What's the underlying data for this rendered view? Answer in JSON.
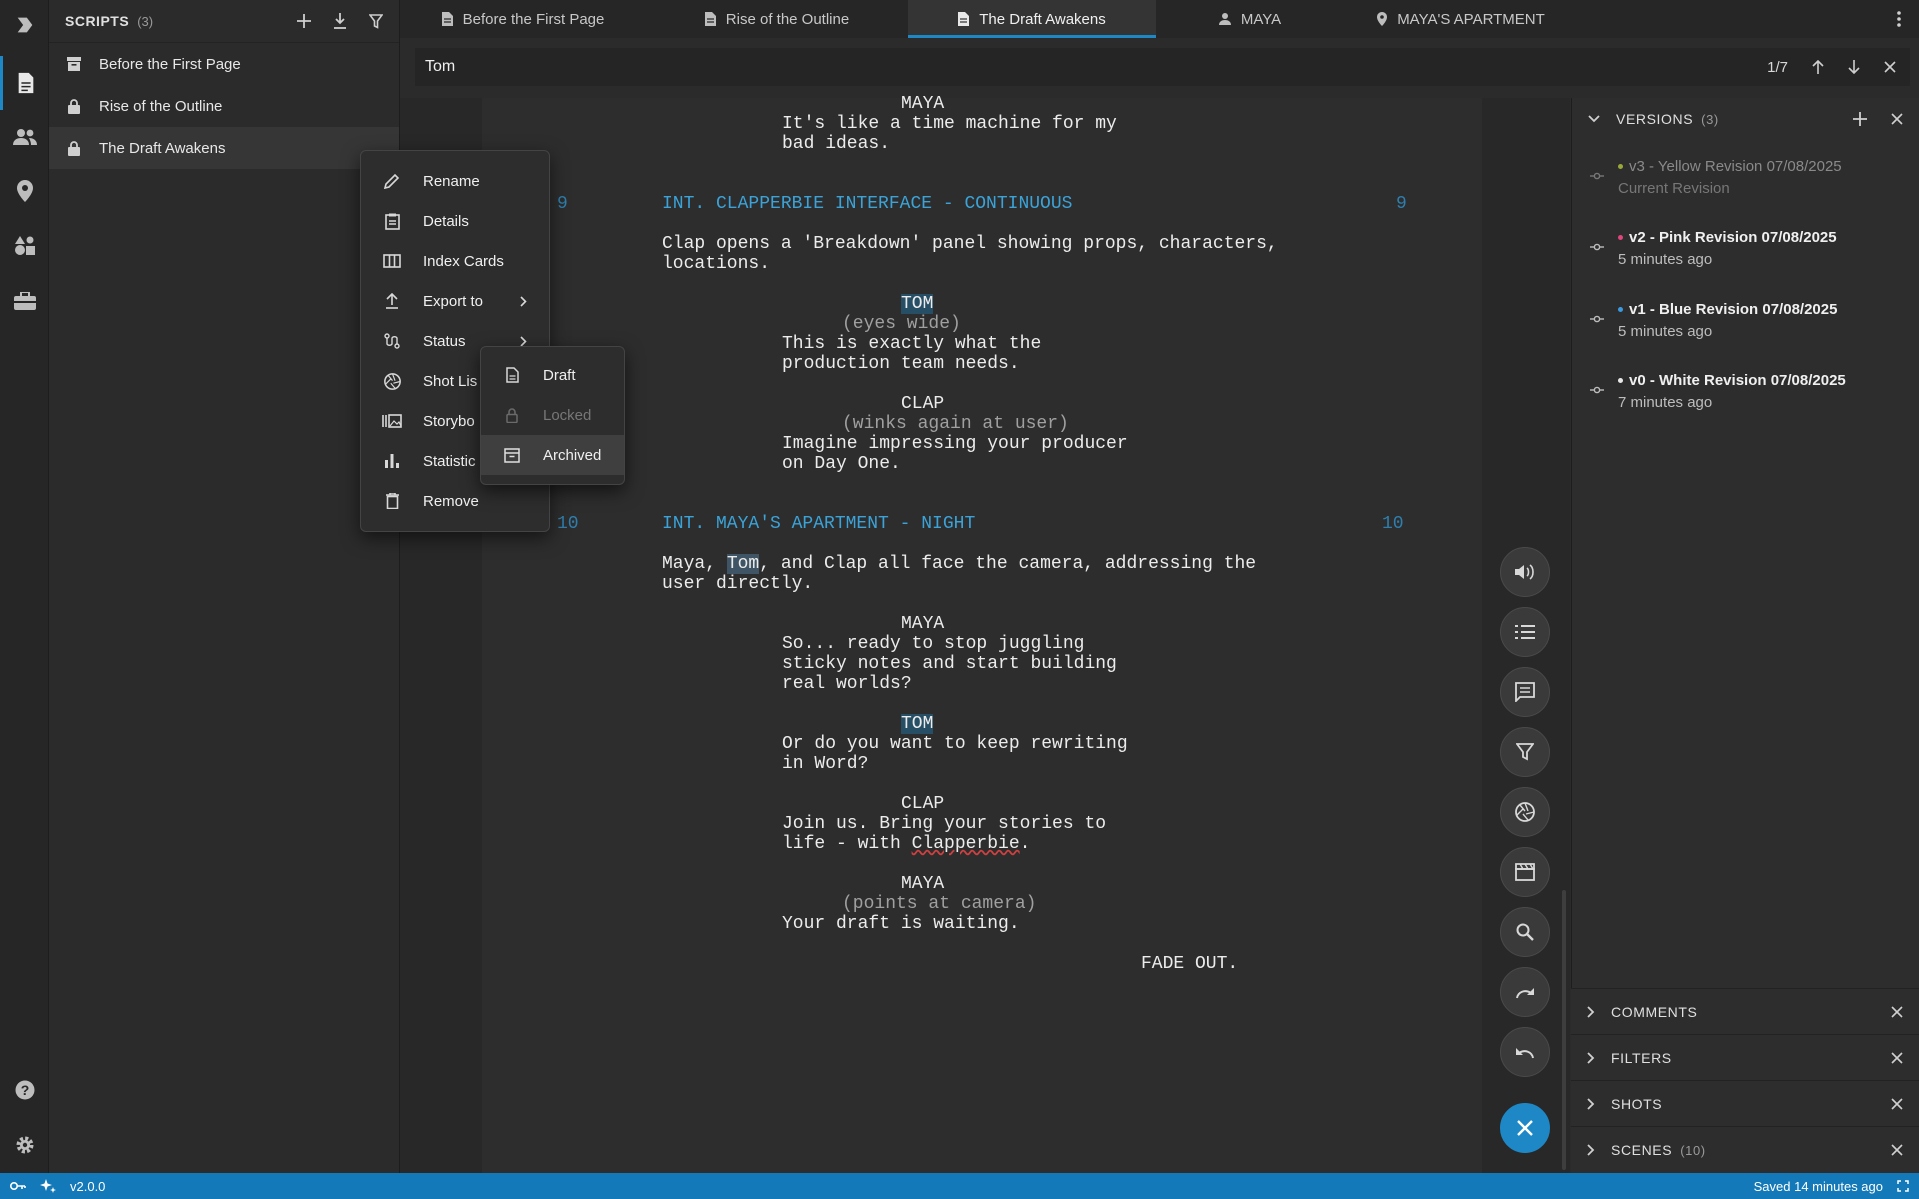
{
  "sidebar": {
    "title": "SCRIPTS",
    "count": "(3)",
    "items": [
      {
        "label": "Before the First Page",
        "icon": "archive-icon"
      },
      {
        "label": "Rise of the Outline",
        "icon": "lock-icon"
      },
      {
        "label": "The Draft Awakens",
        "icon": "lock-icon"
      }
    ]
  },
  "tabs": [
    {
      "label": "Before the First Page",
      "icon": "document-icon"
    },
    {
      "label": "Rise of the Outline",
      "icon": "document-icon"
    },
    {
      "label": "The Draft Awakens",
      "icon": "document-icon",
      "active": true
    },
    {
      "label": "MAYA",
      "icon": "person-icon"
    },
    {
      "label": "MAYA'S APARTMENT",
      "icon": "location-pin-icon"
    }
  ],
  "search": {
    "value": "Tom",
    "counter": "1/7"
  },
  "screenplay": {
    "l1": "MAYA",
    "l2": "It's like a time machine for my",
    "l3": "bad ideas.",
    "scene9_num": "9",
    "scene9_heading": "INT. CLAPPERBIE INTERFACE - CONTINUOUS",
    "l4": "Clap opens a 'Breakdown' panel showing props, characters,",
    "l5": "locations.",
    "tom1": "TOM",
    "l6": "(eyes wide)",
    "l7": "This is exactly what the",
    "l8": "production team needs.",
    "clap1": "CLAP",
    "l9": "(winks again at user)",
    "l10": "Imagine impressing your producer",
    "l11": "on Day One.",
    "scene10_num": "10",
    "scene10_heading": "INT. MAYA'S APARTMENT - NIGHT",
    "l12a": "Maya, ",
    "l12b": "Tom",
    "l12c": ", and Clap all face the camera, addressing the",
    "l13": "user directly.",
    "maya2": "MAYA",
    "l14": "So... ready to stop juggling",
    "l15": "sticky notes and start building",
    "l16": "real worlds?",
    "tom2": "TOM",
    "l17": "Or do you want to keep rewriting",
    "l18": "in Word?",
    "clap2": "CLAP",
    "l19": "Join us. Bring your stories to",
    "l20a": "life - with ",
    "l20b": "Clapperbie",
    "l20c": ".",
    "maya3": "MAYA",
    "l21": "(points at camera)",
    "l22": "Your draft is waiting.",
    "fade": "FADE OUT."
  },
  "context_menu": {
    "items": [
      "Rename",
      "Details",
      "Index Cards",
      "Export to",
      "Status",
      "Shot Lis",
      "Storybo",
      "Statistic",
      "Remove"
    ]
  },
  "status_submenu": {
    "items": [
      {
        "label": "Draft",
        "state": "normal"
      },
      {
        "label": "Locked",
        "state": "disabled"
      },
      {
        "label": "Archived",
        "state": "hover"
      }
    ]
  },
  "versions": {
    "title": "VERSIONS",
    "count": "(3)",
    "items": [
      {
        "title": "v3 - Yellow Revision 07/08/2025",
        "sub": "Current Revision",
        "dot": "#9aa83a"
      },
      {
        "title": "v2 - Pink Revision 07/08/2025",
        "sub": "5 minutes ago",
        "dot": "#e0457b"
      },
      {
        "title": "v1 - Blue Revision 07/08/2025",
        "sub": "5 minutes ago",
        "dot": "#3a9be0"
      },
      {
        "title": "v0 - White Revision 07/08/2025",
        "sub": "7 minutes ago",
        "dot": "#e8e8e8"
      }
    ]
  },
  "panes": {
    "comments": "COMMENTS",
    "filters": "FILTERS",
    "shots": "SHOTS",
    "scenes": "SCENES",
    "scenes_count": "(10)"
  },
  "statusbar": {
    "version": "v2.0.0",
    "saved": "Saved 14 minutes ago"
  },
  "colors": {
    "accent": "#1e88c7",
    "statusbar": "#1479b8",
    "heading": "#3ba3d8"
  }
}
